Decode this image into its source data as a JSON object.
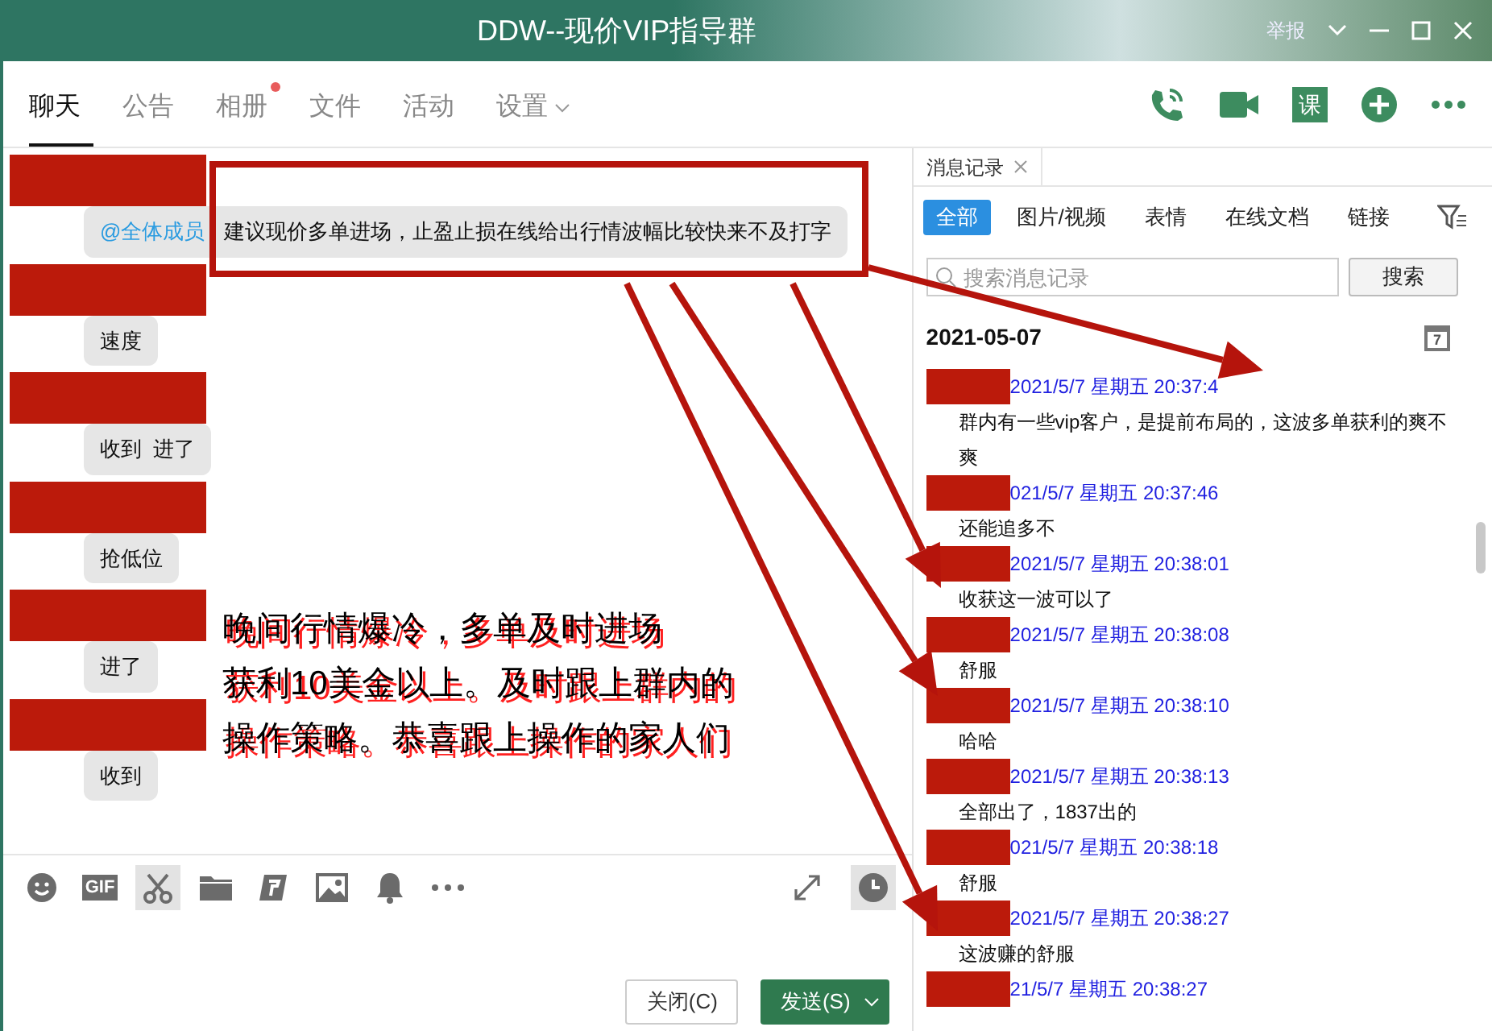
{
  "window": {
    "title": "DDW--现价VIP指导群",
    "report": "举报"
  },
  "tabs": [
    {
      "label": "聊天",
      "selected": true,
      "dot": false,
      "menu": false
    },
    {
      "label": "公告",
      "selected": false,
      "dot": false,
      "menu": false
    },
    {
      "label": "相册",
      "selected": false,
      "dot": true,
      "menu": false
    },
    {
      "label": "文件",
      "selected": false,
      "dot": false,
      "menu": false
    },
    {
      "label": "活动",
      "selected": false,
      "dot": false,
      "menu": false
    },
    {
      "label": "设置",
      "selected": false,
      "dot": false,
      "menu": true
    }
  ],
  "header_actions": [
    {
      "kind": "phone"
    },
    {
      "kind": "video"
    },
    {
      "kind": "course",
      "label": "课"
    },
    {
      "kind": "plus"
    },
    {
      "kind": "more"
    }
  ],
  "messages": [
    {
      "mention": "@全体成员",
      "text": "建议现价多单进场，止盈止损在线给出行情波幅比较快来不及打字"
    },
    {
      "text": "速度"
    },
    {
      "text": "收到  进了"
    },
    {
      "text": "抢低位"
    },
    {
      "text": "进了"
    },
    {
      "text": "收到"
    }
  ],
  "toolbar": [
    {
      "kind": "emoji",
      "selected": false
    },
    {
      "kind": "gif",
      "label": "GIF",
      "selected": false
    },
    {
      "kind": "scissors",
      "selected": true
    },
    {
      "kind": "folder",
      "selected": false
    },
    {
      "kind": "doc",
      "selected": false
    },
    {
      "kind": "image",
      "selected": false
    },
    {
      "kind": "bell",
      "selected": false
    },
    {
      "kind": "more",
      "selected": false
    }
  ],
  "buttons": {
    "close": "关闭(C)",
    "send": "发送(S)"
  },
  "annotation": {
    "lines": [
      "晚间行情爆冷，多单及时进场",
      "获利10美金以上。及时跟上群内的",
      "操作策略。恭喜跟上操作的家人们"
    ]
  },
  "history": {
    "title": "消息记录",
    "filters": [
      {
        "label": "全部",
        "selected": true
      },
      {
        "label": "图片/视频",
        "selected": false
      },
      {
        "label": "表情",
        "selected": false
      },
      {
        "label": "在线文档",
        "selected": false
      },
      {
        "label": "链接",
        "selected": false
      }
    ],
    "search": {
      "placeholder": "搜索消息记录",
      "button": "搜索"
    },
    "date": "2021-05-07",
    "calendar_day": "7",
    "entries": [
      {
        "time": "2021/5/7 星期五 20:37:4",
        "text": "群内有一些vip客户，是提前布局的，这波多单获利的爽不爽"
      },
      {
        "time": "021/5/7 星期五 20:37:46",
        "text": "还能追多不"
      },
      {
        "time": "2021/5/7 星期五 20:38:01",
        "text": "收获这一波可以了"
      },
      {
        "time": "2021/5/7 星期五 20:38:08",
        "text": "舒服"
      },
      {
        "time": "2021/5/7 星期五 20:38:10",
        "text": "哈哈"
      },
      {
        "time": "2021/5/7 星期五 20:38:13",
        "text": "全部出了，1837出的"
      },
      {
        "time": "021/5/7 星期五 20:38:18",
        "text": "舒服"
      },
      {
        "time": "2021/5/7 星期五 20:38:27",
        "text": "这波赚的舒服"
      },
      {
        "time": "21/5/7 星期五 20:38:27"
      }
    ]
  }
}
